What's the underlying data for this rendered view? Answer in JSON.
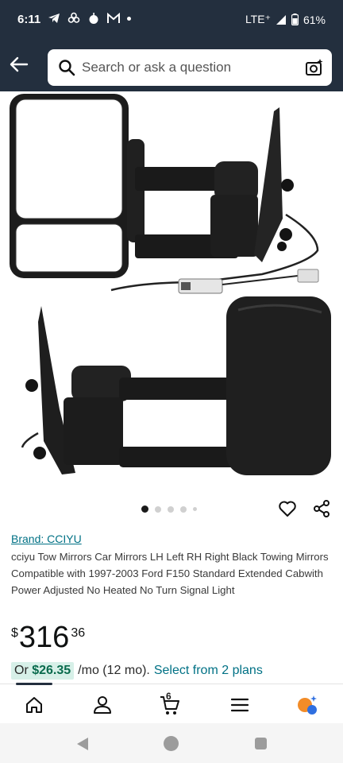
{
  "status_bar": {
    "time": "6:11",
    "network": "LTE⁺",
    "battery": "61%"
  },
  "search": {
    "placeholder": "Search or ask a question"
  },
  "product": {
    "brand": "Brand: CCIYU",
    "title": "cciyu Tow Mirrors Car Mirrors LH Left RH Right Black Towing Mirrors Compatible with 1997-2003 Ford F150 Standard Extended Cabwith Power Adjusted No Heated No Turn Signal Light",
    "price": {
      "symbol": "$",
      "whole": "316",
      "fraction": "36"
    },
    "monthly": {
      "prefix": "Or",
      "amount": "$26.35",
      "suffix": "/mo (12 mo).",
      "link": "Select from 2 plans"
    }
  },
  "carousel": {
    "count": 5,
    "active": 1
  },
  "bottom_nav": {
    "cart_count": "6"
  }
}
